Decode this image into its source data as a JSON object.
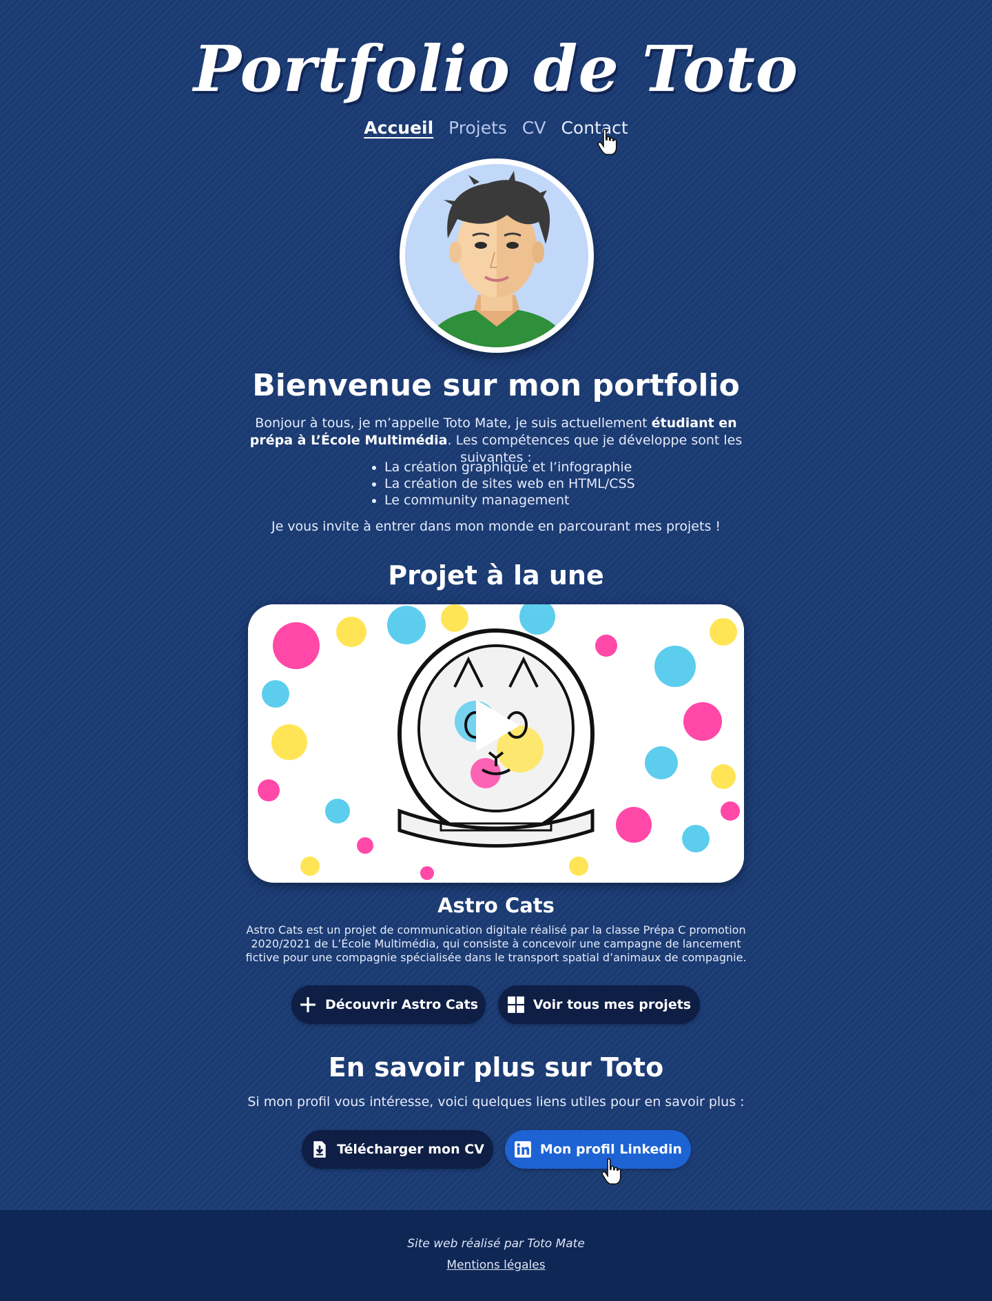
{
  "site": {
    "title": "Portfolio de Toto"
  },
  "nav": {
    "items": [
      {
        "label": "Accueil",
        "state": "active"
      },
      {
        "label": "Projets",
        "state": "normal"
      },
      {
        "label": "CV",
        "state": "normal"
      },
      {
        "label": "Contact",
        "state": "hover"
      }
    ]
  },
  "welcome": {
    "heading": "Bienvenue sur mon portfolio",
    "intro_part1": "Bonjour à tous, je m’appelle Toto Mate, je suis actuellement ",
    "intro_bold": "étudiant en prépa à L’École Multimédia",
    "intro_part2": ". Les compétences que je développe sont les suivantes :",
    "skills": [
      "La création graphique et l’infographie",
      "La création de sites web en HTML/CSS",
      "Le community management"
    ],
    "invite": "Je vous invite à entrer dans mon monde en parcourant mes projets !"
  },
  "featured": {
    "heading": "Projet à la une",
    "project_title": "Astro Cats",
    "description": "Astro Cats est un projet de communication digitale réalisé par la classe Prépa C promotion 2020/2021 de L’École Multimédia, qui consiste à concevoir une campagne de lancement fictive pour une compagnie spécialisée dans le transport spatial d’animaux de compagnie.",
    "buttons": {
      "discover": {
        "label": "Découvrir Astro Cats",
        "icon": "plus-icon"
      },
      "all_projects": {
        "label": "Voir tous mes projets",
        "icon": "grid-icon"
      }
    }
  },
  "more": {
    "heading": "En savoir plus sur Toto",
    "text": "Si mon profil vous intéresse, voici quelques liens utiles pour en savoir plus :",
    "buttons": {
      "cv": {
        "label": "Télécharger mon CV",
        "icon": "file-download-icon"
      },
      "linkedin": {
        "label": "Mon profil Linkedin",
        "icon": "linkedin-icon"
      }
    }
  },
  "footer": {
    "credit": "Site web réalisé par Toto Mate",
    "legal": "Mentions légales"
  },
  "colors": {
    "background": "#1a3a72",
    "footer": "#0f2755",
    "dark_button": "#0e1e44",
    "accent_blue": "#1d63d3"
  }
}
